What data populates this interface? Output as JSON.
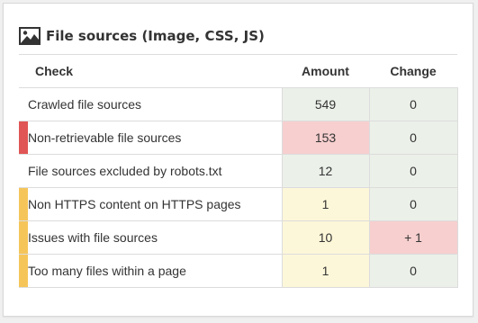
{
  "card": {
    "title": "File sources (Image, CSS, JS)",
    "icon": "image-icon"
  },
  "table": {
    "headers": {
      "check": "Check",
      "amount": "Amount",
      "change": "Change"
    },
    "colors": {
      "neutral": "#ebf0e9",
      "error": "#f7cfcf",
      "warning": "#fdf7d9",
      "marker_error": "#e05555",
      "marker_warning": "#f5c55a"
    },
    "rows": [
      {
        "label": "Crawled file sources",
        "amount": "549",
        "change": "0",
        "severity": "none",
        "amount_status": "neutral",
        "change_status": "neutral"
      },
      {
        "label": "Non-retrievable file sources",
        "amount": "153",
        "change": "0",
        "severity": "error",
        "amount_status": "error",
        "change_status": "neutral"
      },
      {
        "label": "File sources excluded by robots.txt",
        "amount": "12",
        "change": "0",
        "severity": "none",
        "amount_status": "neutral",
        "change_status": "neutral"
      },
      {
        "label": "Non HTTPS content on HTTPS pages",
        "amount": "1",
        "change": "0",
        "severity": "warning",
        "amount_status": "warning",
        "change_status": "neutral"
      },
      {
        "label": "Issues with file sources",
        "amount": "10",
        "change": "+ 1",
        "severity": "warning",
        "amount_status": "warning",
        "change_status": "error"
      },
      {
        "label": "Too many files within a page",
        "amount": "1",
        "change": "0",
        "severity": "warning",
        "amount_status": "warning",
        "change_status": "neutral"
      }
    ]
  }
}
